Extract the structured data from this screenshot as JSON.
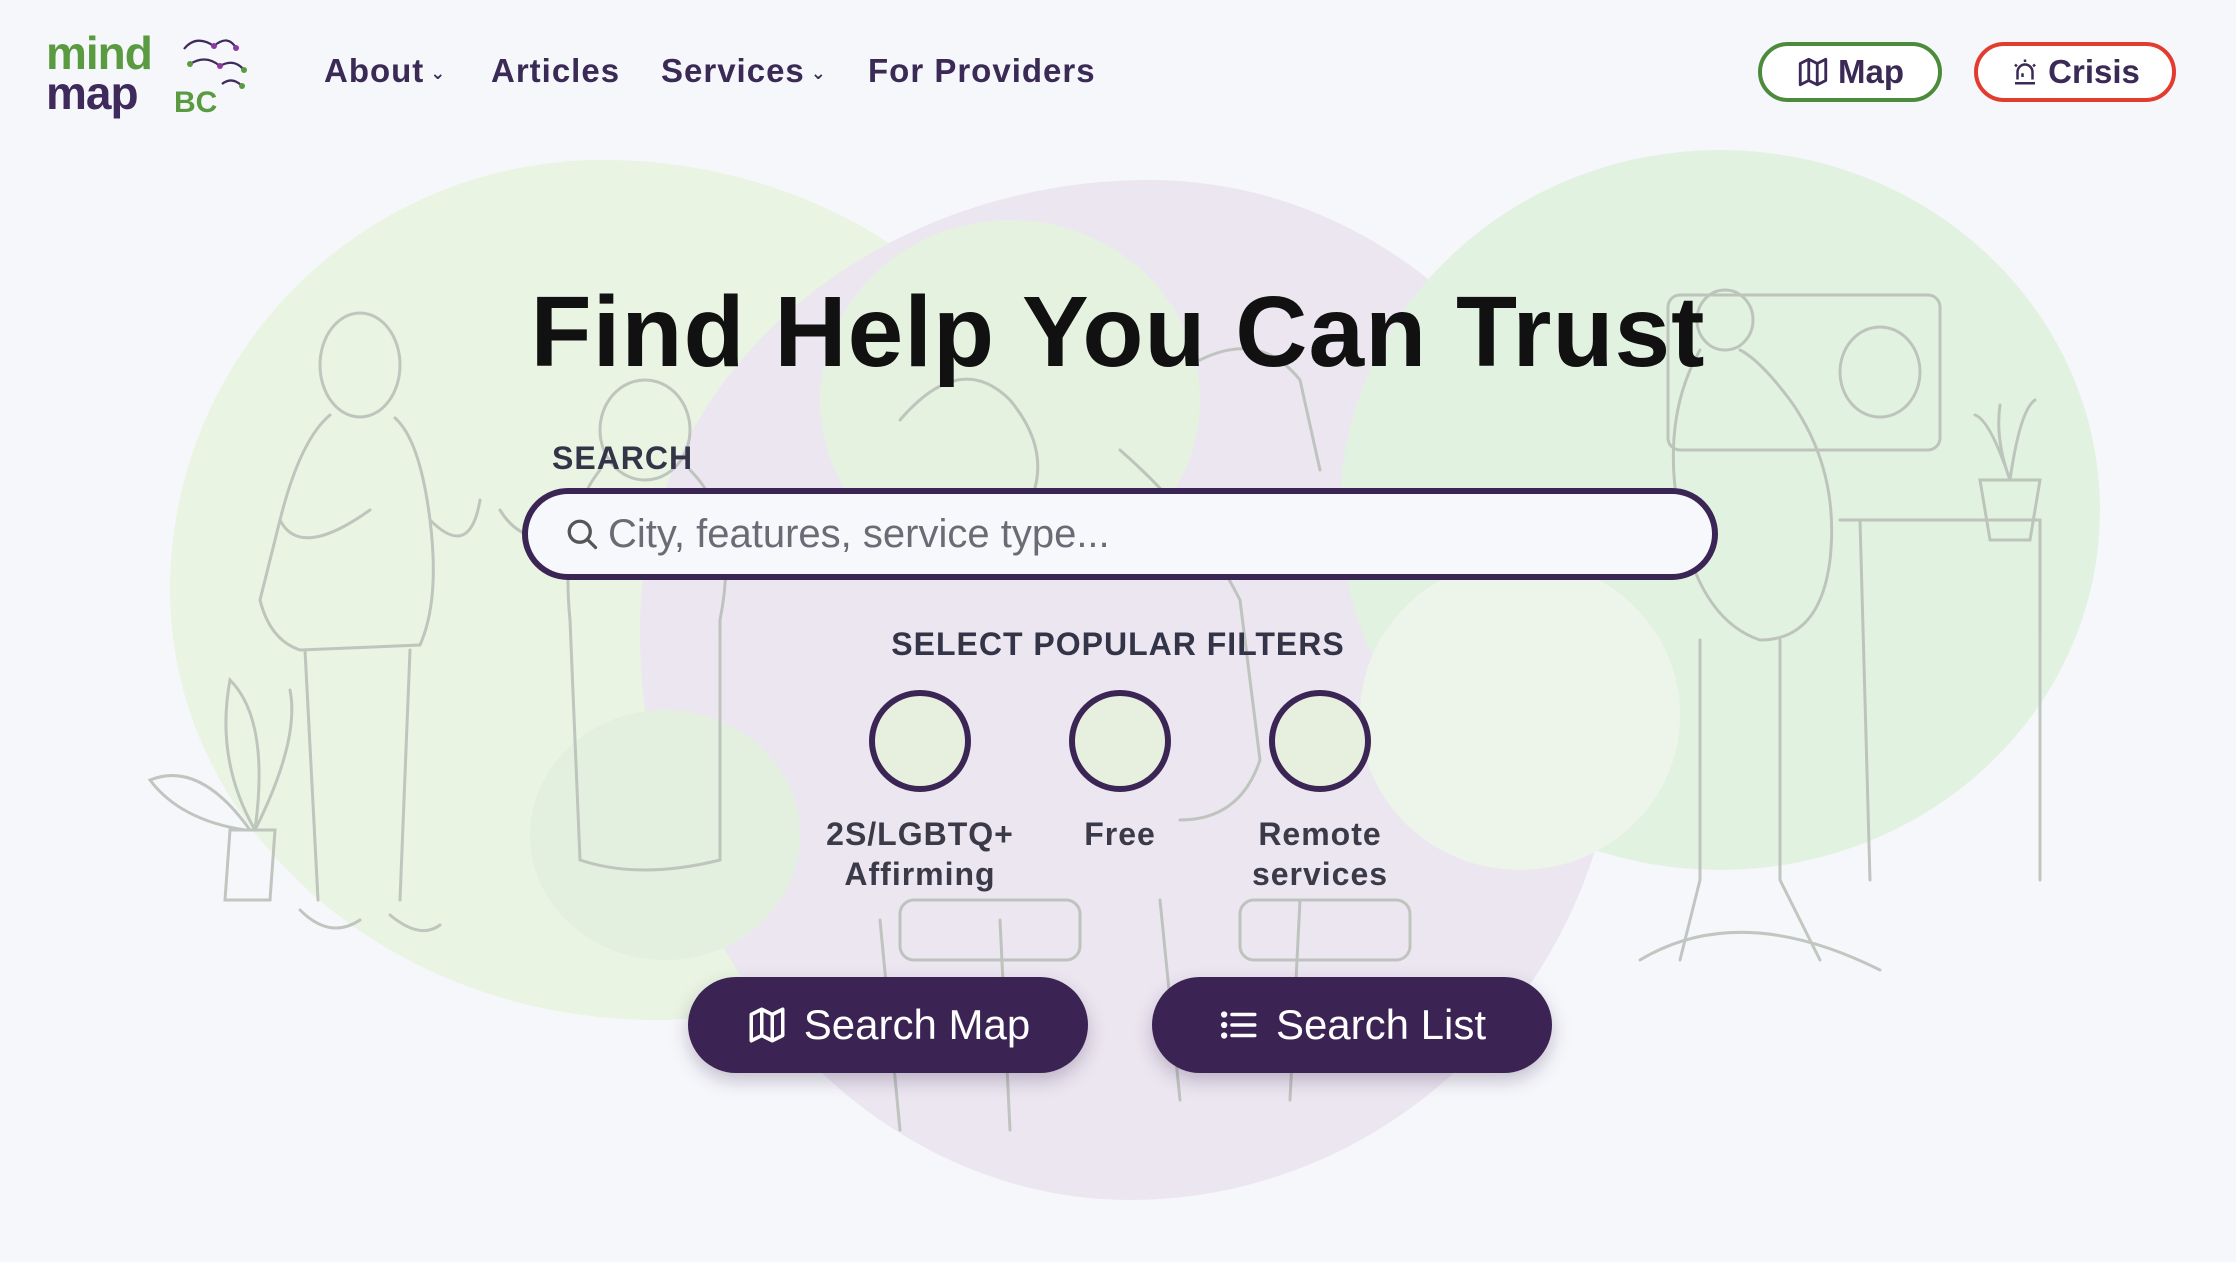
{
  "logo": {
    "line1": "mind",
    "line2": "map",
    "suffix": "BC"
  },
  "nav": {
    "about": "About",
    "articles": "Articles",
    "services": "Services",
    "providers": "For Providers"
  },
  "header_buttons": {
    "map": "Map",
    "crisis": "Crisis"
  },
  "hero": {
    "title": "Find Help You Can Trust"
  },
  "search": {
    "label": "SEARCH",
    "placeholder": "City, features, service type..."
  },
  "filters": {
    "label": "SELECT POPULAR FILTERS",
    "items": [
      {
        "line1": "2S/LGBTQ+",
        "line2": "Affirming"
      },
      {
        "line1": "Free",
        "line2": ""
      },
      {
        "line1": "Remote",
        "line2": "services"
      }
    ]
  },
  "actions": {
    "search_map": "Search Map",
    "search_list": "Search List"
  },
  "colors": {
    "primary": "#3b2354",
    "green": "#5a9a41",
    "crisis_red": "#e33b2e"
  },
  "icons": {
    "map": "map-icon",
    "crisis": "siren-icon",
    "search": "search-icon",
    "list": "list-icon"
  }
}
